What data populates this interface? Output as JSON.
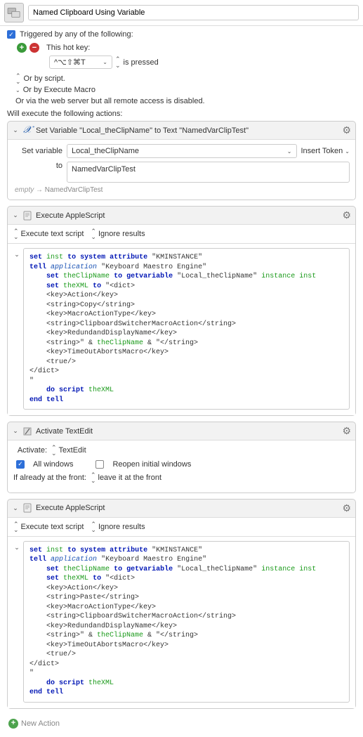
{
  "header": {
    "title": "Named Clipboard Using Variable"
  },
  "trigger": {
    "heading": "Triggered by any of the following:",
    "hotkey_label": "This hot key:",
    "hotkey_value": "^⌥⇧⌘T",
    "hotkey_suffix": "is pressed",
    "by_script": "Or by script.",
    "by_execute_macro": "Or by Execute Macro",
    "webserver_line": "Or via the web server but all remote access is disabled."
  },
  "exec_header": "Will execute the following actions:",
  "action_setvar": {
    "title": "Set Variable \"Local_theClipName\" to Text \"NamedVarClipTest\"",
    "label_setvar": "Set variable",
    "var_name": "Local_theClipName",
    "insert_token": "Insert Token",
    "label_to": "to",
    "text_value": "NamedVarClipTest",
    "hint_empty": "empty",
    "hint_arrow": "→",
    "hint_result": "NamedVarClipTest"
  },
  "action_script1": {
    "title": "Execute AppleScript",
    "mode": "Execute text script",
    "results": "Ignore results",
    "code": {
      "l1a": "set",
      "l1b": "inst",
      "l1c": "to",
      "l1d": "system attribute",
      "l1e": "\"KMINSTANCE\"",
      "l2a": "tell",
      "l2b": "application",
      "l2c": "\"Keyboard Maestro Engine\"",
      "l3a": "set",
      "l3b": "theClipName",
      "l3c": "to",
      "l3d": "getvariable",
      "l3e": "\"Local_theClipName\"",
      "l3f": "instance",
      "l3g": "inst",
      "l4a": "set",
      "l4b": "theXML",
      "l4c": "to",
      "l4d": "\"<dict>",
      "l5": "    <key>Action</key>",
      "l6": "    <string>Copy</string>",
      "l7": "    <key>MacroActionType</key>",
      "l8": "    <string>ClipboardSwitcherMacroAction</string>",
      "l9": "    <key>RedundandDisplayName</key>",
      "l10a": "    <string>\" & ",
      "l10b": "theClipName",
      "l10c": " & \"</string>",
      "l11": "    <key>TimeOutAbortsMacro</key>",
      "l12": "    <true/>",
      "l13": "</dict>",
      "l14": "\"",
      "l15a": "do script",
      "l15b": "theXML",
      "l16": "end tell"
    }
  },
  "action_activate": {
    "title": "Activate TextEdit",
    "label_activate": "Activate:",
    "app": "TextEdit",
    "all_windows": "All windows",
    "reopen": "Reopen initial windows",
    "front_label": "If already at the front:",
    "front_value": "leave it at the front"
  },
  "action_script2": {
    "title": "Execute AppleScript",
    "mode": "Execute text script",
    "results": "Ignore results",
    "code": {
      "l1a": "set",
      "l1b": "inst",
      "l1c": "to",
      "l1d": "system attribute",
      "l1e": "\"KMINSTANCE\"",
      "l2a": "tell",
      "l2b": "application",
      "l2c": "\"Keyboard Maestro Engine\"",
      "l3a": "set",
      "l3b": "theClipName",
      "l3c": "to",
      "l3d": "getvariable",
      "l3e": "\"Local_theClipName\"",
      "l3f": "instance",
      "l3g": "inst",
      "l4a": "set",
      "l4b": "theXML",
      "l4c": "to",
      "l4d": "\"<dict>",
      "l5": "    <key>Action</key>",
      "l6": "    <string>Paste</string>",
      "l7": "    <key>MacroActionType</key>",
      "l8": "    <string>ClipboardSwitcherMacroAction</string>",
      "l9": "    <key>RedundandDisplayName</key>",
      "l10a": "    <string>\" & ",
      "l10b": "theClipName",
      "l10c": " & \"</string>",
      "l11": "    <key>TimeOutAbortsMacro</key>",
      "l12": "    <true/>",
      "l13": "</dict>",
      "l14": "\"",
      "l15a": "do script",
      "l15b": "theXML",
      "l16": "end tell"
    }
  },
  "footer": {
    "new_action": "New Action"
  }
}
